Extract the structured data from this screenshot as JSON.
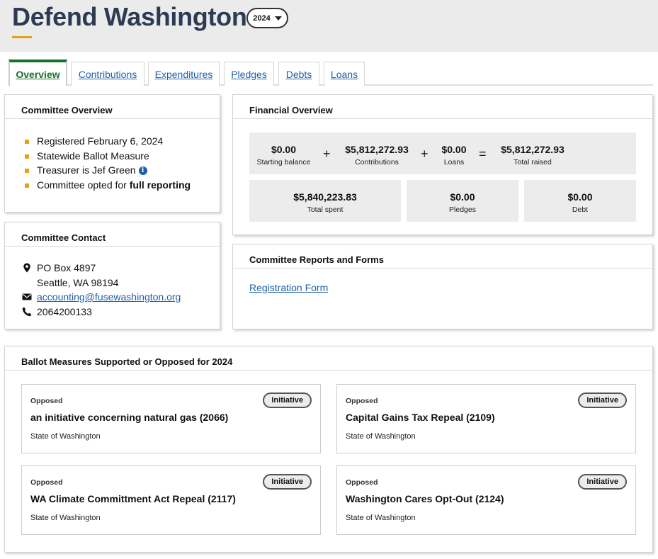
{
  "header": {
    "title": "Defend Washington",
    "year_select": "2024"
  },
  "tabs": [
    {
      "label": "Overview",
      "active": true
    },
    {
      "label": "Contributions"
    },
    {
      "label": "Expenditures"
    },
    {
      "label": "Pledges"
    },
    {
      "label": "Debts"
    },
    {
      "label": "Loans"
    }
  ],
  "committee_overview": {
    "title": "Committee Overview",
    "items": {
      "registered": "Registered February 6, 2024",
      "type": "Statewide Ballot Measure",
      "treasurer": "Treasurer is Jef Green",
      "reporting_prefix": "Committee opted for ",
      "reporting_value": "full reporting"
    }
  },
  "committee_contact": {
    "title": "Committee Contact",
    "address_line1": "PO Box 4897",
    "address_line2": "Seattle, WA 98194",
    "email": "accounting@fusewashington.org",
    "phone": "2064200133"
  },
  "financial_overview": {
    "title": "Financial Overview",
    "starting_balance": {
      "value": "$0.00",
      "label": "Starting balance"
    },
    "contributions": {
      "value": "$5,812,272.93",
      "label": "Contributions"
    },
    "loans": {
      "value": "$0.00",
      "label": "Loans"
    },
    "total_raised": {
      "value": "$5,812,272.93",
      "label": "Total raised"
    },
    "total_spent": {
      "value": "$5,840,223.83",
      "label": "Total spent"
    },
    "pledges": {
      "value": "$0.00",
      "label": "Pledges"
    },
    "debt": {
      "value": "$0.00",
      "label": "Debt"
    },
    "op_plus": "+",
    "op_equals": "="
  },
  "reports": {
    "title": "Committee Reports and Forms",
    "registration_link": "Registration Form"
  },
  "ballot_measures": {
    "title": "Ballot Measures Supported or Opposed for 2024",
    "items": [
      {
        "stance": "Opposed",
        "badge": "Initiative",
        "title": "an initiative concerning natural gas (2066)",
        "jurisdiction": "State of Washington"
      },
      {
        "stance": "Opposed",
        "badge": "Initiative",
        "title": "Capital Gains Tax Repeal (2109)",
        "jurisdiction": "State of Washington"
      },
      {
        "stance": "Opposed",
        "badge": "Initiative",
        "title": "WA Climate Committment Act Repeal (2117)",
        "jurisdiction": "State of Washington"
      },
      {
        "stance": "Opposed",
        "badge": "Initiative",
        "title": "Washington Cares Opt-Out (2124)",
        "jurisdiction": "State of Washington"
      }
    ]
  },
  "colors": {
    "accent": "#e0a21b",
    "link": "#1f5fa8",
    "active_tab": "#1a6e2e",
    "title": "#2c3a52"
  }
}
